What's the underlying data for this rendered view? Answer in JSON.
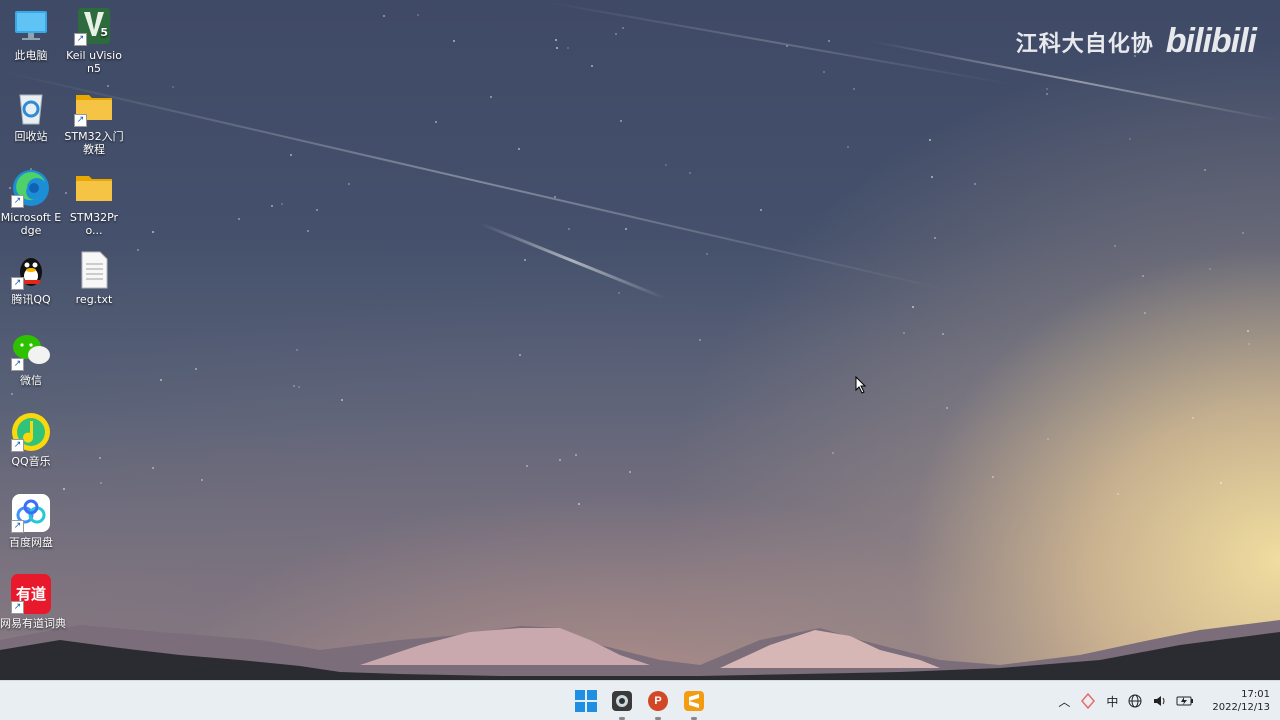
{
  "watermark": {
    "text": "江科大自化协",
    "logo": "bilibili"
  },
  "desktop_icons": [
    {
      "name": "this-pc",
      "label": "此电脑",
      "icon": "monitor-icon",
      "shortcut": false
    },
    {
      "name": "recycle-bin",
      "label": "回收站",
      "icon": "recycle-bin-icon",
      "shortcut": false
    },
    {
      "name": "microsoft-edge",
      "label": "Microsoft Edge",
      "icon": "edge-icon",
      "shortcut": true
    },
    {
      "name": "tencent-qq",
      "label": "腾讯QQ",
      "icon": "qq-penguin-icon",
      "shortcut": true
    },
    {
      "name": "wechat",
      "label": "微信",
      "icon": "wechat-icon",
      "shortcut": true
    },
    {
      "name": "qq-music",
      "label": "QQ音乐",
      "icon": "qq-music-icon",
      "shortcut": true
    },
    {
      "name": "baidu-netdisk",
      "label": "百度网盘",
      "icon": "baidu-netdisk-icon",
      "shortcut": true
    },
    {
      "name": "youdao-dict",
      "label": "网易有道词典",
      "icon": "youdao-icon",
      "icon_text": "有道",
      "shortcut": true
    },
    {
      "name": "keil-uvision5",
      "label": "Keil uVision5",
      "icon": "keil-icon",
      "icon_text": "5",
      "shortcut": true
    },
    {
      "name": "stm32-tutorial",
      "label": "STM32入门教程",
      "icon": "folder-icon",
      "shortcut": true
    },
    {
      "name": "stm32pro",
      "label": "STM32Pro...",
      "icon": "folder-icon",
      "shortcut": false
    },
    {
      "name": "reg-txt",
      "label": "reg.txt",
      "icon": "text-file-icon",
      "shortcut": false
    }
  ],
  "taskbar": {
    "apps": [
      {
        "name": "start",
        "icon": "windows-start-icon",
        "running": false
      },
      {
        "name": "camera",
        "icon": "camera-icon",
        "running": true
      },
      {
        "name": "powerpoint",
        "icon": "powerpoint-icon",
        "icon_text": "P",
        "running": true
      },
      {
        "name": "sublime",
        "icon": "sublime-icon",
        "running": true
      }
    ],
    "tray": {
      "ime": "中",
      "time": "17:01",
      "date": "2022/12/13"
    }
  },
  "colors": {
    "taskbar_bg": "#e9eef3",
    "folder": "#f6c445",
    "youdao_red": "#e8192c",
    "powerpoint": "#d24726"
  }
}
